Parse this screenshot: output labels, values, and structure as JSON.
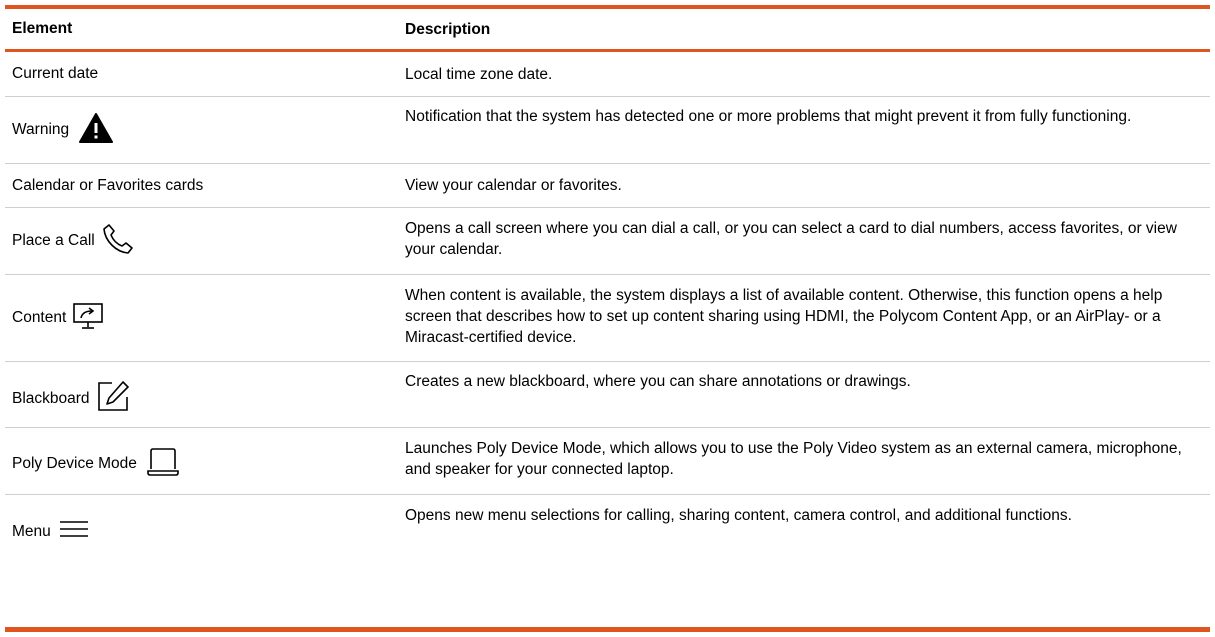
{
  "table": {
    "headers": [
      "Element",
      "Description"
    ],
    "rows": [
      {
        "element": "Current date",
        "icon": null,
        "description": "Local time zone date."
      },
      {
        "element": "Warning",
        "icon": "warning-icon",
        "description": "Notification that the system has detected one or more problems that might prevent it from fully functioning."
      },
      {
        "element": "Calendar or Favorites cards",
        "icon": null,
        "description": "View your calendar or favorites."
      },
      {
        "element": "Place a Call",
        "icon": "phone-icon",
        "description": "Opens a call screen where you can dial a call, or you can select a card to dial numbers, access favorites, or view your calendar."
      },
      {
        "element": "Content",
        "icon": "content-share-icon",
        "description": "When content is available, the system displays a list of available content. Otherwise, this function opens a help screen that describes how to set up content sharing using HDMI, the Polycom Content App, or an AirPlay- or a Miracast-certified device."
      },
      {
        "element": "Blackboard",
        "icon": "blackboard-pencil-icon",
        "description": "Creates a new blackboard, where you can share annotations or drawings."
      },
      {
        "element": "Poly Device Mode",
        "icon": "laptop-icon",
        "description": "Launches Poly Device Mode, which allows you to use the Poly Video system as an external camera, microphone, and speaker for your connected laptop."
      },
      {
        "element": "Menu",
        "icon": "hamburger-menu-icon",
        "description": "Opens new menu selections for calling, sharing content, camera control, and additional functions."
      }
    ]
  },
  "colors": {
    "accent": "#e0551f",
    "rule": "#cfcfcf"
  }
}
